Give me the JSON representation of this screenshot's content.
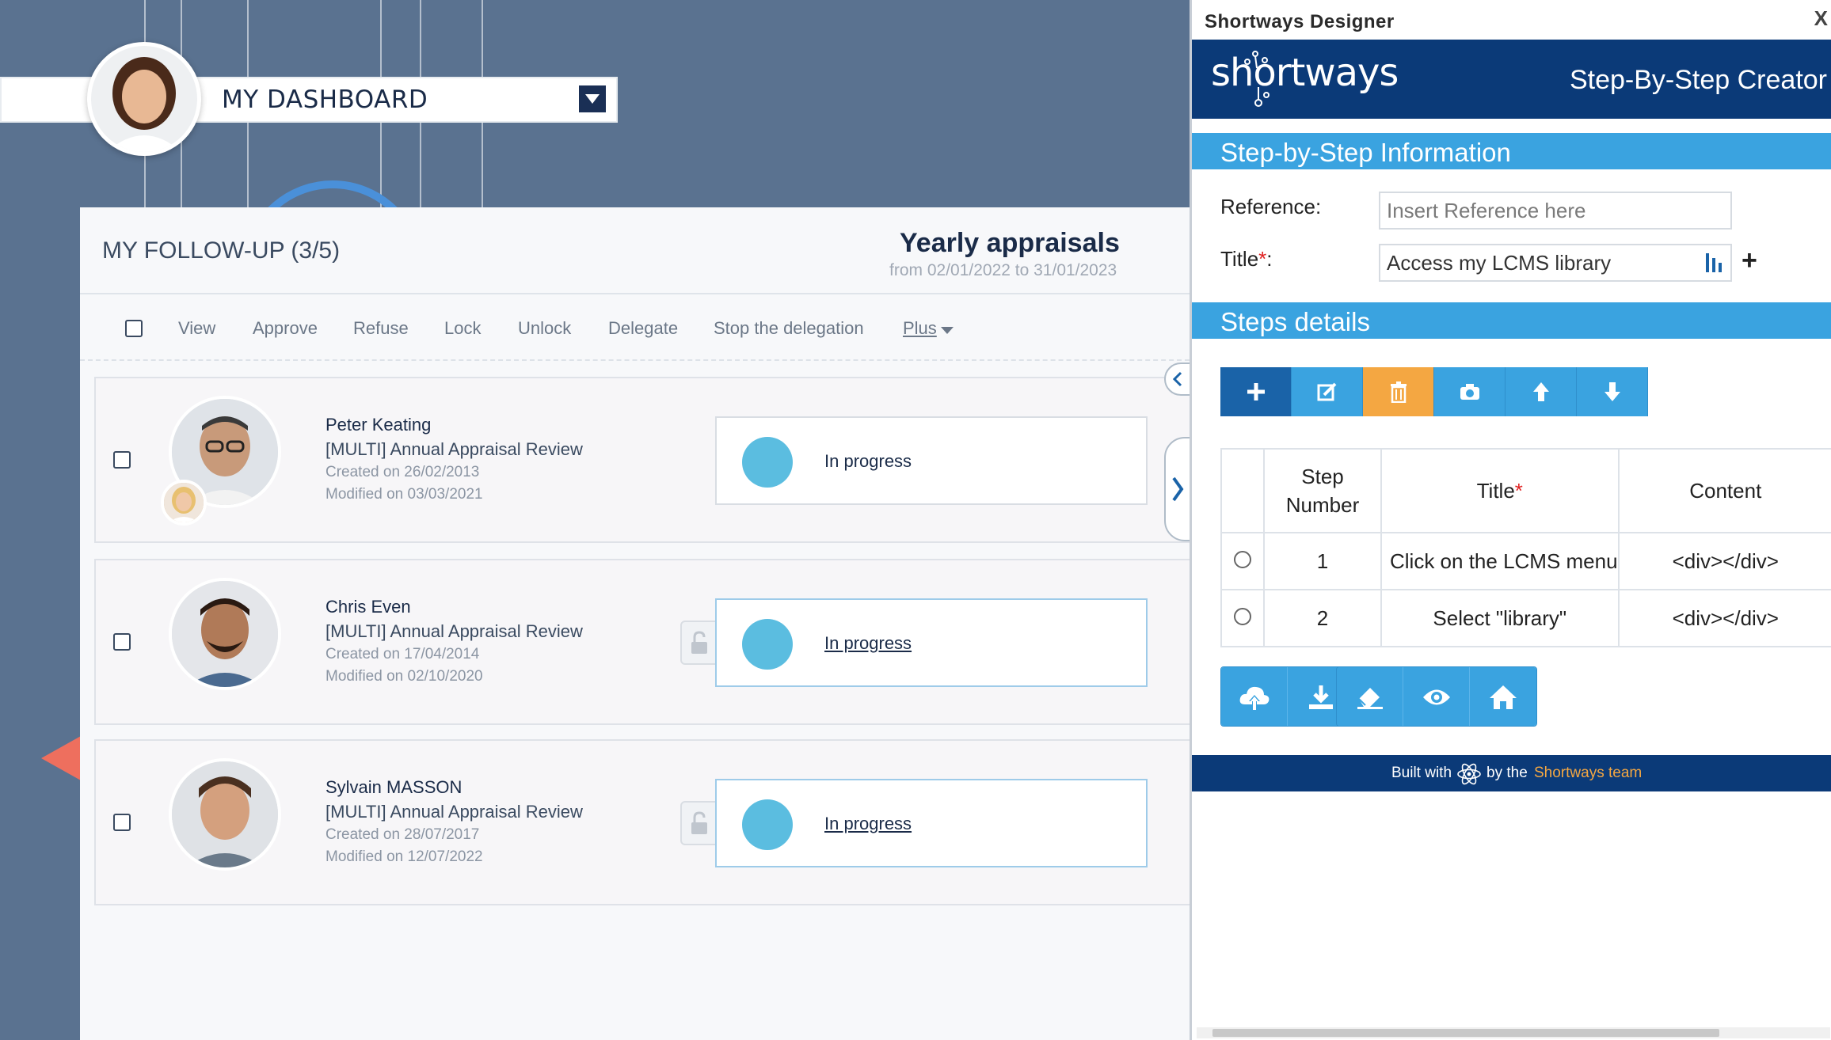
{
  "dashboard": {
    "title": "MY DASHBOARD"
  },
  "followup": {
    "title": "MY FOLLOW-UP (3/5)",
    "campaign_title": "Yearly appraisals",
    "campaign_range": "from 02/01/2022 to 31/01/2023"
  },
  "toolbar": {
    "view": "View",
    "approve": "Approve",
    "refuse": "Refuse",
    "lock": "Lock",
    "unlock": "Unlock",
    "delegate": "Delegate",
    "stop_delegation": "Stop the delegation",
    "plus": "Plus"
  },
  "cards": [
    {
      "name": "Peter Keating",
      "review": "[MULTI] Annual Appraisal Review",
      "created": "Created on 26/02/2013",
      "modified": "Modified on 03/03/2021",
      "status": "In progress"
    },
    {
      "name": "Chris Even",
      "review": "[MULTI] Annual Appraisal Review",
      "created": "Created on 17/04/2014",
      "modified": "Modified on 02/10/2020",
      "status": "In progress"
    },
    {
      "name": "Sylvain MASSON",
      "review": "[MULTI] Annual Appraisal Review",
      "created": "Created on 28/07/2017",
      "modified": "Modified on 12/07/2022",
      "status": "In progress"
    }
  ],
  "designer": {
    "window_title": "Shortways Designer",
    "close": "X",
    "logo": "shortways",
    "subtitle": "Step-By-Step Creator",
    "section_info": "Step-by-Step Information",
    "reference_label": "Reference:",
    "reference_placeholder": "Insert Reference here",
    "title_label": "Title",
    "title_required": "*",
    "title_colon": ":",
    "title_value": "Access my LCMS library",
    "section_steps": "Steps details",
    "table": {
      "headers": [
        "Step Number",
        "Title",
        "Content"
      ],
      "title_required": "*",
      "rows": [
        {
          "number": "1",
          "title": "Click on the LCMS menu",
          "content": "<div></div>"
        },
        {
          "number": "2",
          "title": "Select \"library\"",
          "content": "<div></div>"
        }
      ]
    },
    "footer": {
      "built_with": "Built with",
      "by_the": "by the",
      "team": "Shortways team"
    }
  },
  "colors": {
    "background": "#5a7290",
    "designer_header": "#0b3a78",
    "section_bar": "#3aa3e0",
    "status_dot": "#5bbde0",
    "accent_orange": "#f4a742"
  }
}
